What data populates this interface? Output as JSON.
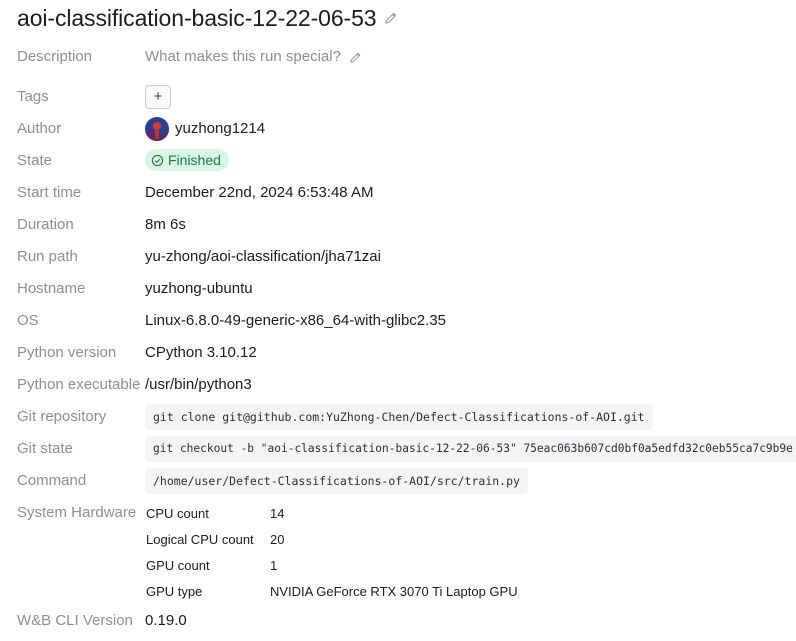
{
  "run": {
    "title": "aoi-classification-basic-12-22-06-53",
    "edit_icon": "pencil-icon"
  },
  "fields": {
    "description": {
      "label": "Description",
      "placeholder": "What makes this run special?"
    },
    "tags": {
      "label": "Tags",
      "add_label": "+"
    },
    "author": {
      "label": "Author",
      "value": "yuzhong1214"
    },
    "state": {
      "label": "State",
      "value": "Finished",
      "color": "#1f7a45",
      "bg": "#d9f5e3"
    },
    "start_time": {
      "label": "Start time",
      "value": "December 22nd, 2024 6:53:48 AM"
    },
    "duration": {
      "label": "Duration",
      "value": "8m 6s"
    },
    "run_path": {
      "label": "Run path",
      "value": "yu-zhong/aoi-classification/jha71zai"
    },
    "hostname": {
      "label": "Hostname",
      "value": "yuzhong-ubuntu"
    },
    "os": {
      "label": "OS",
      "value": "Linux-6.8.0-49-generic-x86_64-with-glibc2.35"
    },
    "python_version": {
      "label": "Python version",
      "value": "CPython 3.10.12"
    },
    "python_executable": {
      "label": "Python executable",
      "value": "/usr/bin/python3"
    },
    "git_repository": {
      "label": "Git repository",
      "value": "git clone git@github.com:YuZhong-Chen/Defect-Classifications-of-AOI.git"
    },
    "git_state": {
      "label": "Git state",
      "value": "git checkout -b \"aoi-classification-basic-12-22-06-53\" 75eac063b607cd0bf0a5edfd32c0eb55ca7c9b9e"
    },
    "command": {
      "label": "Command",
      "value": "/home/user/Defect-Classifications-of-AOI/src/train.py"
    },
    "system_hardware": {
      "label": "System Hardware",
      "items": [
        {
          "key": "CPU count",
          "value": "14"
        },
        {
          "key": "Logical CPU count",
          "value": "20"
        },
        {
          "key": "GPU count",
          "value": "1"
        },
        {
          "key": "GPU type",
          "value": "NVIDIA GeForce RTX 3070 Ti Laptop GPU"
        }
      ]
    },
    "cli_version": {
      "label": "W&B CLI Version",
      "value": "0.19.0"
    }
  }
}
